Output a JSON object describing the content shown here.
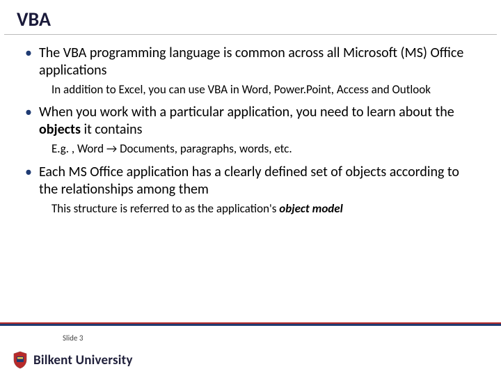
{
  "title": "VBA",
  "bullets": [
    {
      "text": "The VBA programming language is common across all Microsoft (MS) Office applications",
      "sub": "In addition to Excel, you can use VBA in Word, Power.Point, Access and Outlook"
    },
    {
      "text_before": "When you work with a particular application, you need to learn about the ",
      "bold": "objects",
      "text_after": " it contains",
      "sub_before": "E.g. , Word ",
      "arrow": "→",
      "sub_after": " Documents, paragraphs, words, etc."
    },
    {
      "text": "Each MS Office application has a clearly defined set of objects according to the relationships among them",
      "sub_before": "This structure is referred to as the application's ",
      "boldit": "object model"
    }
  ],
  "footer": {
    "slide_label": "Slide 3",
    "university": "Bilkent University"
  }
}
